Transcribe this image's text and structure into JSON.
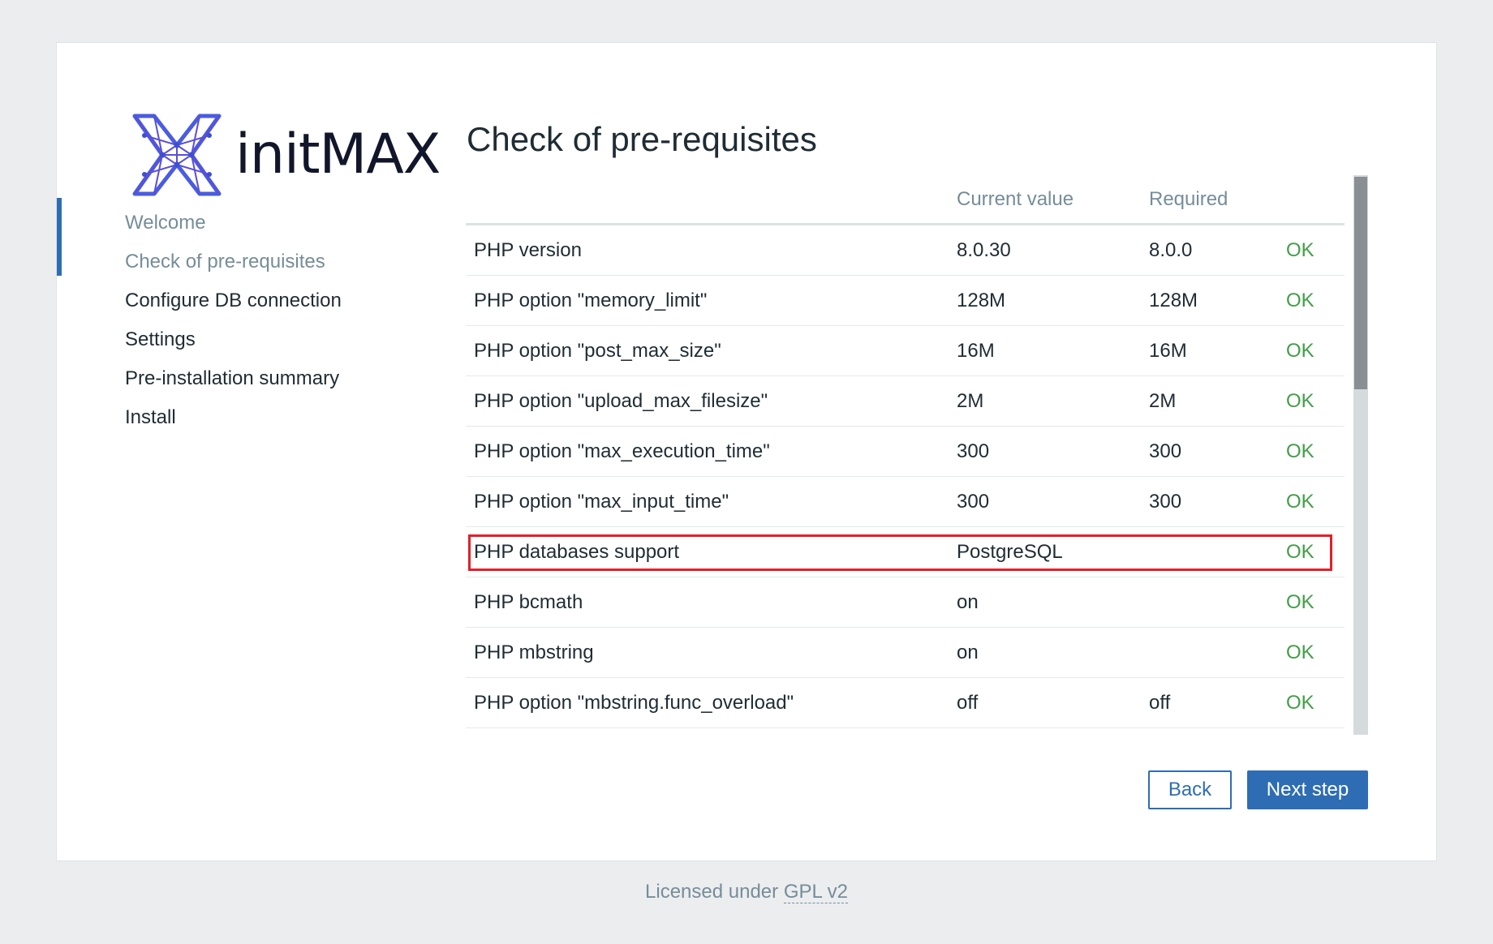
{
  "brand": {
    "name": "initMAX",
    "accent_color": "#4a5ce0"
  },
  "steps": [
    {
      "label": "Welcome",
      "state": "done"
    },
    {
      "label": "Check of pre-requisites",
      "state": "current"
    },
    {
      "label": "Configure DB connection",
      "state": "pending"
    },
    {
      "label": "Settings",
      "state": "pending"
    },
    {
      "label": "Pre-installation summary",
      "state": "pending"
    },
    {
      "label": "Install",
      "state": "pending"
    }
  ],
  "page": {
    "title": "Check of pre-requisites"
  },
  "table": {
    "columns": [
      "",
      "Current value",
      "Required",
      ""
    ],
    "rows": [
      {
        "name": "PHP version",
        "current": "8.0.30",
        "required": "8.0.0",
        "status": "OK"
      },
      {
        "name": "PHP option \"memory_limit\"",
        "current": "128M",
        "required": "128M",
        "status": "OK"
      },
      {
        "name": "PHP option \"post_max_size\"",
        "current": "16M",
        "required": "16M",
        "status": "OK"
      },
      {
        "name": "PHP option \"upload_max_filesize\"",
        "current": "2M",
        "required": "2M",
        "status": "OK"
      },
      {
        "name": "PHP option \"max_execution_time\"",
        "current": "300",
        "required": "300",
        "status": "OK"
      },
      {
        "name": "PHP option \"max_input_time\"",
        "current": "300",
        "required": "300",
        "status": "OK"
      },
      {
        "name": "PHP databases support",
        "current": "PostgreSQL",
        "required": "",
        "status": "OK"
      },
      {
        "name": "PHP bcmath",
        "current": "on",
        "required": "",
        "status": "OK"
      },
      {
        "name": "PHP mbstring",
        "current": "on",
        "required": "",
        "status": "OK"
      },
      {
        "name": "PHP option \"mbstring.func_overload\"",
        "current": "off",
        "required": "off",
        "status": "OK"
      }
    ]
  },
  "buttons": {
    "back": "Back",
    "next": "Next step"
  },
  "footer": {
    "prefix": "Licensed under ",
    "link": "GPL v2"
  },
  "colors": {
    "primary": "#2e6db4",
    "ok": "#429e47",
    "highlight": "#e0202a",
    "muted": "#768d99"
  }
}
